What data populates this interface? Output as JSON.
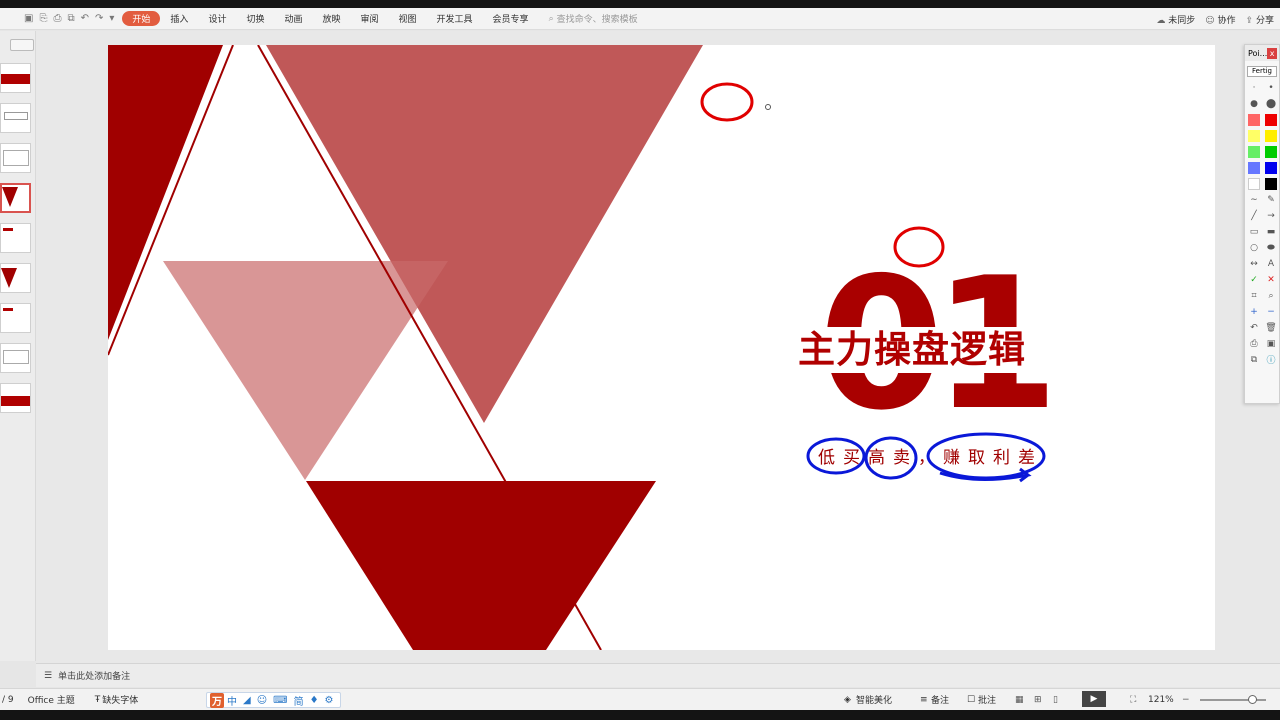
{
  "menubar": {
    "tabs": [
      "开始",
      "插入",
      "设计",
      "切换",
      "动画",
      "放映",
      "审阅",
      "视图",
      "开发工具",
      "会员专享"
    ],
    "active_tab": "开始",
    "search_placeholder": "查找命令、搜索模板",
    "sync_label": "未同步",
    "collab_label": "协作",
    "share_label": "分享"
  },
  "slide": {
    "big_number": "01",
    "title": "主力操盘逻辑",
    "subtitle": "低买高卖，赚取利差",
    "colors": {
      "dark_red": "#a00000",
      "mid_red": "#c05555",
      "light_red": "#d99393",
      "ink_blue": "#0a18d8",
      "ink_red": "#e00000"
    }
  },
  "notes": {
    "placeholder": "单击此处添加备注"
  },
  "status": {
    "page": "/ 9",
    "theme": "Office 主题",
    "missing_fonts": "缺失字体",
    "smart_beautify": "智能美化",
    "notes_btn": "备注",
    "comments_btn": "批注",
    "zoom": "121%"
  },
  "ime": {
    "items": [
      "中",
      "简"
    ]
  },
  "pointer_panel": {
    "title": "Poi...",
    "button": "Fertig",
    "close": "x",
    "colors": [
      "#ff6666",
      "#ee0000",
      "#ffff66",
      "#ffee00",
      "#66ee66",
      "#00cc00",
      "#6677ff",
      "#0000ee",
      "#ffffff",
      "#000000"
    ]
  }
}
